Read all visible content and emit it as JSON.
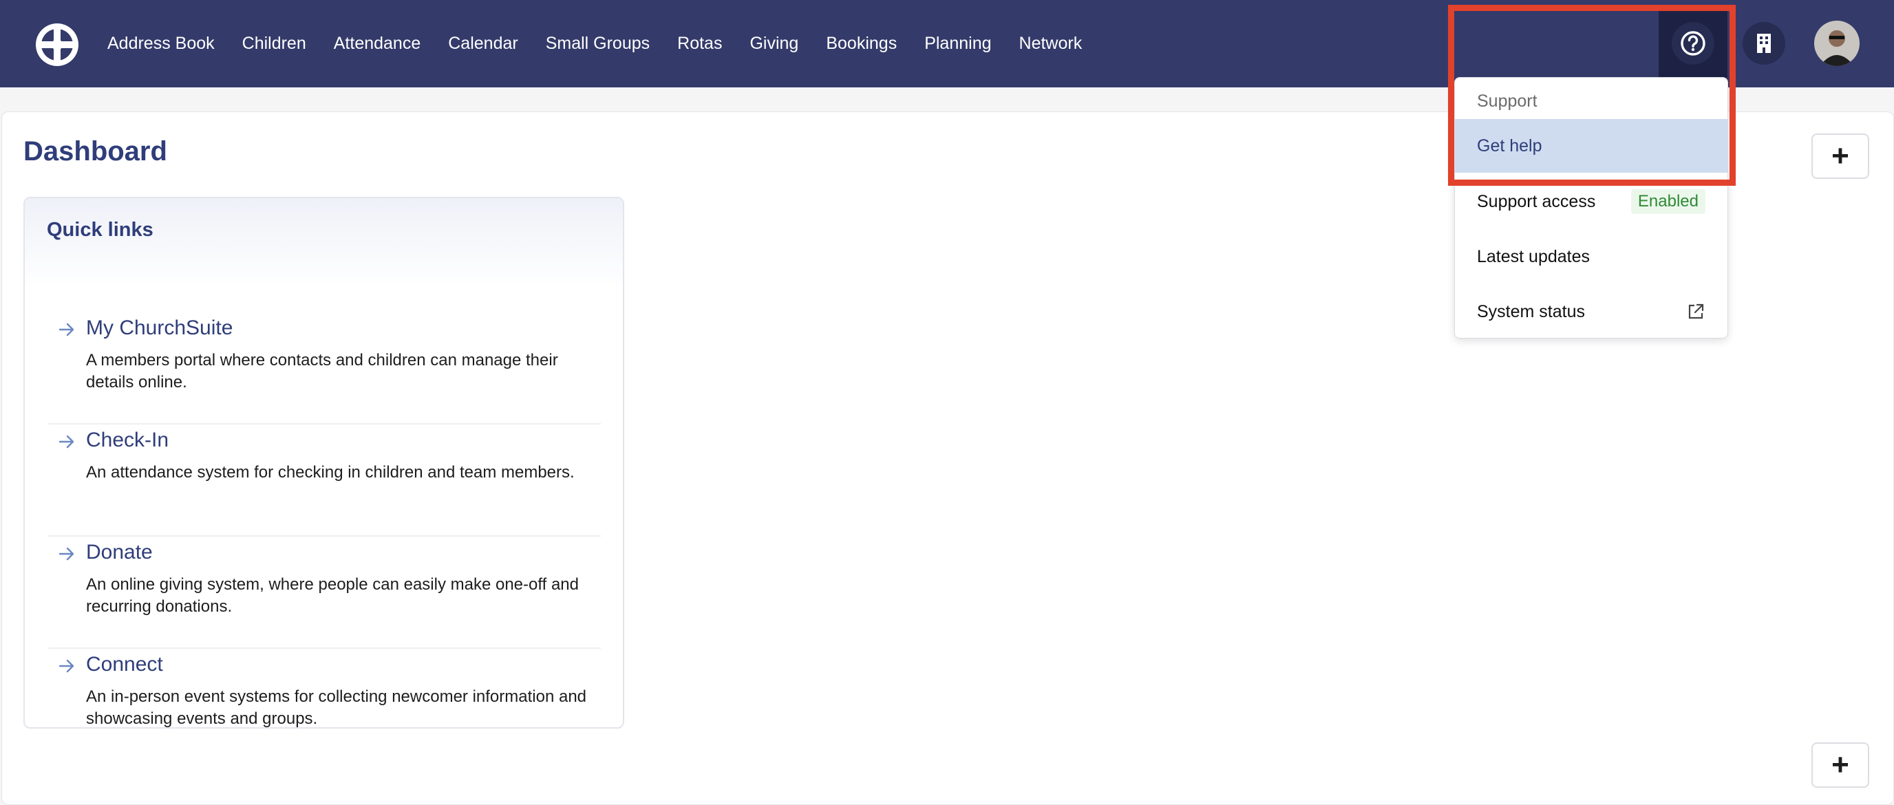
{
  "nav": {
    "items": [
      "Address Book",
      "Children",
      "Attendance",
      "Calendar",
      "Small Groups",
      "Rotas",
      "Giving",
      "Bookings",
      "Planning",
      "Network"
    ]
  },
  "icons": {
    "logo": "church-logo-icon",
    "help": "question-circle-icon",
    "building": "building-icon",
    "plus": "plus-icon",
    "external": "external-link-icon",
    "arrow": "arrow-right-icon"
  },
  "main": {
    "title": "Dashboard",
    "add_label": "+"
  },
  "quick_links": {
    "title": "Quick links",
    "items": [
      {
        "title": "My ChurchSuite",
        "desc": "A members portal where contacts and children can manage their details online."
      },
      {
        "title": "Check-In",
        "desc": "An attendance system for checking in children and team members."
      },
      {
        "title": "Donate",
        "desc": "An online giving system, where people can easily make one-off and recurring donations."
      },
      {
        "title": "Connect",
        "desc": "An in-person event systems for collecting newcomer information and showcasing events and groups."
      }
    ]
  },
  "dropdown": {
    "header": "Support",
    "get_help": "Get help",
    "support_access": "Support access",
    "support_access_badge": "Enabled",
    "latest_updates": "Latest updates",
    "system_status": "System status"
  },
  "colors": {
    "topbar": "#343b6a",
    "accent": "#2f3d7a",
    "active_item": "#cfdcef",
    "highlight": "#e2412c",
    "badge_text": "#2e8b34"
  }
}
